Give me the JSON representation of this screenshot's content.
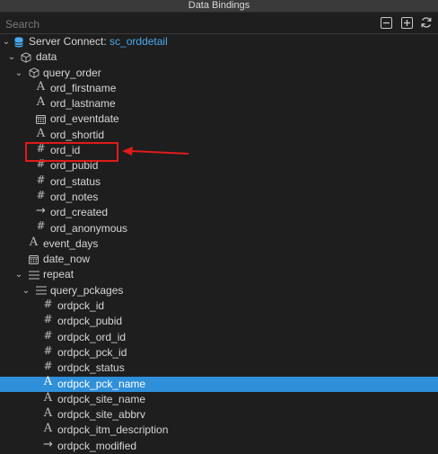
{
  "window": {
    "title": "Data Bindings"
  },
  "search": {
    "placeholder": "Search"
  },
  "colors": {
    "background": "#1e1e1e",
    "selected": "#2f8fd8",
    "link": "#4aa8ef",
    "annotation": "#e01b1b"
  },
  "tree": {
    "server": {
      "prefix": "Server Connect: ",
      "name": "sc_orddetail"
    },
    "data": "data",
    "query_order": "query_order",
    "query_fields": [
      {
        "name": "ord_firstname",
        "icon": "text-icon"
      },
      {
        "name": "ord_lastname",
        "icon": "text-icon"
      },
      {
        "name": "ord_eventdate",
        "icon": "calendar-icon"
      },
      {
        "name": "ord_shortid",
        "icon": "text-icon"
      },
      {
        "name": "ord_id",
        "icon": "number-icon"
      },
      {
        "name": "ord_pubid",
        "icon": "number-icon"
      },
      {
        "name": "ord_status",
        "icon": "number-icon"
      },
      {
        "name": "ord_notes",
        "icon": "number-icon"
      },
      {
        "name": "ord_created",
        "icon": "arrow-icon"
      },
      {
        "name": "ord_anonymous",
        "icon": "number-icon"
      }
    ],
    "event_days": "event_days",
    "date_now": "date_now",
    "repeat": "repeat",
    "query_pckages": "query_pckages",
    "pck_fields": [
      {
        "name": "ordpck_id",
        "icon": "number-icon"
      },
      {
        "name": "ordpck_pubid",
        "icon": "number-icon"
      },
      {
        "name": "ordpck_ord_id",
        "icon": "number-icon"
      },
      {
        "name": "ordpck_pck_id",
        "icon": "number-icon"
      },
      {
        "name": "ordpck_status",
        "icon": "number-icon"
      },
      {
        "name": "ordpck_pck_name",
        "icon": "text-icon"
      },
      {
        "name": "ordpck_site_name",
        "icon": "text-icon"
      },
      {
        "name": "ordpck_site_abbrv",
        "icon": "text-icon"
      },
      {
        "name": "ordpck_itm_description",
        "icon": "text-icon"
      },
      {
        "name": "ordpck_modified",
        "icon": "arrow-icon"
      }
    ]
  }
}
